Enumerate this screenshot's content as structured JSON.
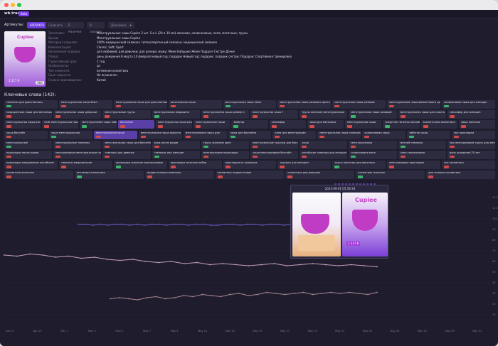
{
  "app": {
    "brand": "wb.tracker",
    "badge": "Beta"
  },
  "articles": {
    "label": "Артикулы:",
    "chips": [
      "60059650",
      "Сравнить",
      "В Наличии",
      "В Заказах",
      "Динамика",
      "+"
    ]
  },
  "product": {
    "thumb_logo": "Cupiee",
    "thumb_price": "1 217 ₽",
    "thumb_badge": "360",
    "props": [
      {
        "k": "Заголовок:",
        "v": "Менструальные чаши Cupiee 2 шт. S и L (20 и 30 мл) женские, силиконовые, капа, месячные, трусы"
      },
      {
        "k": "Бренд:",
        "v": "Менструальные чаши Cupiee"
      },
      {
        "k": "Материал изделия:",
        "v": "100% медицинский силикон; гипоаллергенный силикон; медицинский силикон"
      },
      {
        "k": "Комплектация:",
        "v": "Classic; Soft; Sport"
      },
      {
        "k": "Назначение подарка:",
        "v": "для любимой; для девочки; для дочери; мужу; Маме Бабушке Жене Подруге Сестре Дочке"
      },
      {
        "k": "Повод:",
        "v": "день рождения 8 марта 14 февраля новый год; подарок Новый год; подарок; подарок сестре; Подарок; Спортивная тренировка"
      },
      {
        "k": "Гарантийный срок:",
        "v": "1 год"
      },
      {
        "k": "Особенности:",
        "v": "дз"
      },
      {
        "k": "Тип элемента:",
        "v": "интимная косметика"
      },
      {
        "k": "Срок годности:",
        "v": "Не ограничен"
      },
      {
        "k": "Страна производства:",
        "v": "Китай"
      }
    ]
  },
  "keywords": {
    "title": "Ключевые слова (143):",
    "rows": [
      [
        "тампоны для девственниц",
        "менструальная чаша 30мл",
        "менструальная чаша для девственницы",
        "вагинальная чаша",
        "менструальная чаша 20мл",
        "менструальная чаша розового цвета",
        "менструальная чаша розовая",
        "менструальная чаша фиолетового цвета",
        "силиконовая чаша для женщин"
      ],
      [
        "медицинская чаша для месячных",
        "менструальная чаша девушки",
        "менструальные трусы",
        "менструальная медицина",
        "менструальная чаша размер 1",
        "менструальная чаша 7",
        "трусы женские менструальные",
        "менструальная чаша розовый",
        "менструальная чаша для спорта",
        "сапсифир для женщин"
      ],
      [
        "менструальная чаша размер s",
        "кейс менструальных чаш",
        "менструальная чаша набор",
        "месячные",
        "менструальная чаша размер l",
        "менструальные чаши",
        "заботэр",
        "сапсифир",
        "чаша для месячных",
        "менструальная чаша",
        "средства гигиены личной",
        "экологичная косметика",
        "чаша женская"
      ],
      [
        "чаша бассейн",
        "чаша менструальная",
        "менструальная чаша",
        "менструальная чаша красота",
        "менструальная чаша для",
        "чаша для бассейна",
        "капа для менструации",
        "менструальная чаша силиконовая",
        "силиконовая чаша",
        "заботэр чаша",
        "эко прокладки"
      ],
      [
        "менструальный",
        "менструальные тампоны",
        "менструальная чаша для бассейна",
        "вход после родов",
        "трусы женские хрен",
        "менструальные трусики для бассейна",
        "чаша",
        "менструальные",
        "миткей тампоны",
        "эко многоразовые трусы для женщин"
      ],
      [
        "прокладки после родов",
        "многоразовые менструальные прокладки",
        "тампоны для девочек",
        "тампоны для женщин",
        "многоразовые прокладки",
        "чаши многоразовые бассейн",
        "китайские тампоны для женщин",
        "силиконовая капа",
        "капа силиконовая",
        "день рождения 25 лет"
      ],
      [
        "прокладки ежедневные китайские",
        "тампоны медицинские",
        "прокладки женские многоразовые",
        "прокладки женские набор",
        "прокладки из силикона",
        "трусики для женщин",
        "трусы женские для месячных",
        "многоразовые прокладки",
        "эко косметика"
      ],
      [
        "косметика аптечная",
        "интимная косметика",
        "подростковая косметика",
        "косметика подростковая",
        "косметика для девушек",
        "косметика женская",
        "для женщин косметика"
      ]
    ]
  },
  "chart_data": {
    "type": "line",
    "tooltip_date": "2023-09-01 05:58:34",
    "xticks": [
      "Apr 27",
      "Apr 29",
      "May 1",
      "May 3",
      "May 5",
      "May 7",
      "May 9",
      "May 11",
      "May 13",
      "May 15",
      "May 17",
      "May 19",
      "May 21",
      "May 23",
      "May 25",
      "May 27",
      "May 29",
      "May 31"
    ],
    "yticks": [
      "10",
      "20",
      "30",
      "40",
      "50",
      "60",
      "70",
      "80",
      "90",
      "100",
      "110",
      "120"
    ],
    "series": [
      {
        "color": "#6d60d4",
        "y": [
          95,
          95,
          94,
          95,
          94,
          95,
          95,
          94,
          95,
          94,
          95,
          95,
          94,
          95,
          95,
          94,
          95,
          95,
          94,
          94,
          95,
          95,
          94,
          95,
          95,
          94,
          95,
          95,
          94,
          95
        ]
      },
      {
        "color": "#c69fb6",
        "y": [
          66,
          65,
          67,
          66,
          64,
          65,
          63,
          64,
          62,
          61,
          62,
          60,
          59,
          60,
          58,
          59,
          57,
          58,
          57,
          56,
          57,
          58,
          56,
          57,
          58,
          57,
          56,
          57,
          56,
          55
        ]
      },
      {
        "color": "#a88592",
        "y": [
          25,
          26,
          25,
          24,
          26,
          27,
          25,
          26,
          28,
          27,
          29,
          28,
          27,
          29,
          30,
          28,
          29,
          31,
          30,
          29,
          30,
          31,
          29,
          30,
          31,
          30,
          31,
          30,
          29,
          31
        ]
      }
    ]
  }
}
